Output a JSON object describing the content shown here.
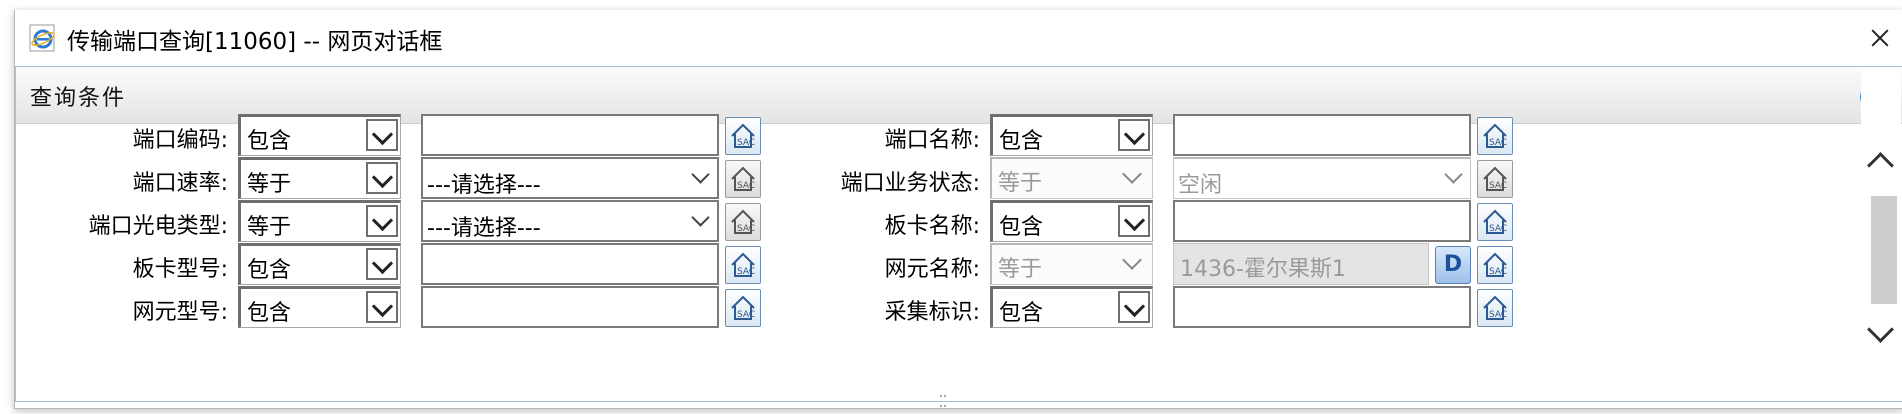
{
  "window": {
    "title": "传输端口查询[11060] -- 网页对话框",
    "icon": "ie-icon"
  },
  "panel": {
    "title": "查询条件"
  },
  "fields": [
    {
      "label": "端口编码:",
      "op": "包含",
      "value": ""
    },
    {
      "label": "端口名称:",
      "op": "包含",
      "value": ""
    },
    {
      "label": "端口速率:",
      "op": "等于",
      "value": "---请选择---"
    },
    {
      "label": "端口业务状态:",
      "op": "等于",
      "value": "空闲"
    },
    {
      "label": "端口光电类型:",
      "op": "等于",
      "value": "---请选择---"
    },
    {
      "label": "板卡名称:",
      "op": "包含",
      "value": ""
    },
    {
      "label": "板卡型号:",
      "op": "包含",
      "value": ""
    },
    {
      "label": "网元名称:",
      "op": "等于",
      "value": "1436-霍尔果斯1",
      "extra_button": "D"
    },
    {
      "label": "网元型号:",
      "op": "包含",
      "value": ""
    },
    {
      "label": "采集标识:",
      "op": "包含",
      "value": ""
    }
  ],
  "colors": {
    "accent": "#3a87c8",
    "panel_border": "#a7c0dc"
  }
}
